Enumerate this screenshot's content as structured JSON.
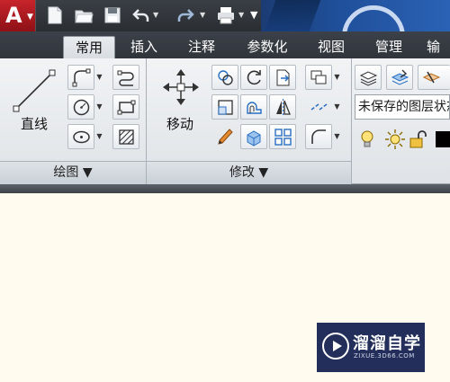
{
  "ribbon_tabs": [
    "常用",
    "插入",
    "注释",
    "参数化",
    "视图",
    "管理",
    "输出"
  ],
  "active_tab": "常用",
  "draw_panel": {
    "title": "绘图 ▼",
    "big_button_label": "直线"
  },
  "modify_panel": {
    "title": "修改 ▼",
    "big_button_label": "移动"
  },
  "layer_panel": {
    "layer_state": "未保存的图层状态"
  },
  "watermark": {
    "brand": "溜溜自学",
    "url": "ZIXUE.3D66.COM"
  },
  "icons": {
    "qat": [
      "new-file-icon",
      "open-folder-icon",
      "save-icon",
      "undo-icon",
      "redo-icon",
      "print-icon",
      "more-icon"
    ],
    "draw": [
      "line-icon",
      "polyline-icon",
      "circle-icon",
      "ellipse-icon",
      "polyline-edit-icon",
      "rectangle-icon",
      "hatch-icon"
    ],
    "modify": [
      "move-icon",
      "copy-icon",
      "rotate-icon",
      "trim-icon",
      "stretch-icon",
      "offset-icon",
      "mirror-icon",
      "break-icon",
      "erase-icon",
      "fillet-icon",
      "array-icon",
      "scale-icon",
      "explode-icon"
    ],
    "layer": [
      "layer-properties-icon",
      "layer-state-icon",
      "layer-isolate-icon",
      "bulb-icon",
      "sun-icon",
      "unlock-icon",
      "color-swatch-icon"
    ]
  },
  "colors": {
    "canvas": "#fffbef",
    "brand_red": "#c8242b",
    "watermark_bg": "#232f5a"
  }
}
